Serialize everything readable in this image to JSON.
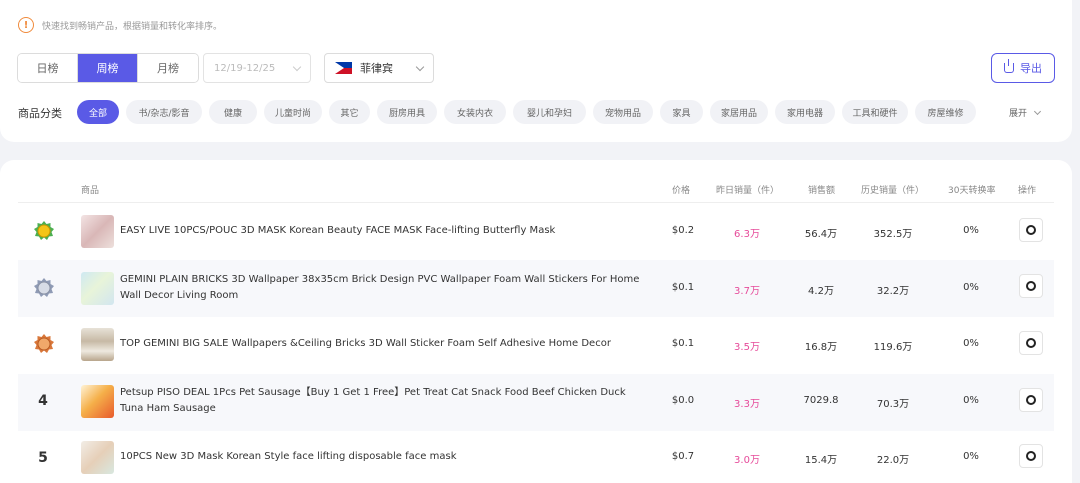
{
  "notice": {
    "text": "快速找到畅销产品，根据销量和转化率排序。"
  },
  "tabs": [
    "日榜",
    "周榜",
    "月榜"
  ],
  "active_tab": 1,
  "date_range": {
    "placeholder": "12/19-12/25"
  },
  "country": {
    "name": "菲律宾"
  },
  "export": {
    "label": "导出"
  },
  "category": {
    "label": "商品分类",
    "chips": [
      "全部",
      "书/杂志/影音",
      "健康",
      "儿童时尚",
      "其它",
      "厨房用具",
      "女装内衣",
      "婴儿和孕妇",
      "宠物用品",
      "家具",
      "家居用品",
      "家用电器",
      "工具和硬件",
      "房屋维修"
    ],
    "active_chip": 0,
    "expand_label": "展开"
  },
  "table": {
    "headers": {
      "product": "商品",
      "price": "价格",
      "yesterday_sales": "昨日销量（件）",
      "revenue": "销售额",
      "total_sales": "历史销量（件）",
      "conversion": "30天转换率",
      "action": "操作"
    },
    "rows": [
      {
        "rank": "1",
        "medal": "gold",
        "title": "EASY LIVE 10PCS/POUC 3D MASK Korean Beauty FACE MASK Face-lifting Butterfly Mask",
        "price": "$0.2",
        "yesterday": "6.3万",
        "revenue": "56.4万",
        "total": "352.5万",
        "conversion": "0%"
      },
      {
        "rank": "2",
        "medal": "silver",
        "title": "GEMINI PLAIN BRICKS 3D Wallpaper 38x35cm Brick Design PVC Wallpaper Foam Wall Stickers For Home Wall Decor Living Room",
        "price": "$0.1",
        "yesterday": "3.7万",
        "revenue": "4.2万",
        "total": "32.2万",
        "conversion": "0%"
      },
      {
        "rank": "3",
        "medal": "bronze",
        "title": "TOP GEMINI BIG SALE Wallpapers &Ceiling Bricks 3D Wall Sticker Foam Self Adhesive Home Decor",
        "price": "$0.1",
        "yesterday": "3.5万",
        "revenue": "16.8万",
        "total": "119.6万",
        "conversion": "0%"
      },
      {
        "rank": "4",
        "medal": "",
        "title": "Petsup PISO DEAL 1Pcs Pet Sausage【Buy 1 Get 1 Free】Pet Treat Cat Snack Food Beef Chicken Duck Tuna Ham Sausage",
        "price": "$0.0",
        "yesterday": "3.3万",
        "revenue": "7029.8",
        "total": "70.3万",
        "conversion": "0%"
      },
      {
        "rank": "5",
        "medal": "",
        "title": "10PCS New 3D Mask Korean Style face lifting disposable face mask",
        "price": "$0.7",
        "yesterday": "3.0万",
        "revenue": "15.4万",
        "total": "22.0万",
        "conversion": "0%"
      }
    ]
  },
  "colors": {
    "accent": "#5a5ae6",
    "highlight": "#e64b9a",
    "warning": "#f08b3d"
  }
}
